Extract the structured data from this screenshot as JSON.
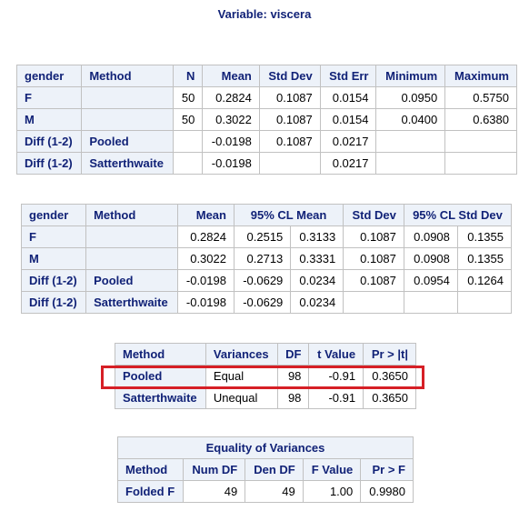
{
  "title": "Variable: viscera",
  "stats_table": {
    "headers": [
      "gender",
      "Method",
      "N",
      "Mean",
      "Std Dev",
      "Std Err",
      "Minimum",
      "Maximum"
    ],
    "rows": [
      [
        "F",
        "",
        "50",
        "0.2824",
        "0.1087",
        "0.0154",
        "0.0950",
        "0.5750"
      ],
      [
        "M",
        "",
        "50",
        "0.3022",
        "0.1087",
        "0.0154",
        "0.0400",
        "0.6380"
      ],
      [
        "Diff (1-2)",
        "Pooled",
        "",
        "-0.0198",
        "0.1087",
        "0.0217",
        "",
        ""
      ],
      [
        "Diff (1-2)",
        "Satterthwaite",
        "",
        "-0.0198",
        "",
        "0.0217",
        "",
        ""
      ]
    ]
  },
  "cl_table": {
    "headers": [
      "gender",
      "Method",
      "Mean",
      "95% CL Mean",
      "Std Dev",
      "95% CL Std Dev"
    ],
    "rows": [
      [
        "F",
        "",
        "0.2824",
        "0.2515",
        "0.3133",
        "0.1087",
        "0.0908",
        "0.1355"
      ],
      [
        "M",
        "",
        "0.3022",
        "0.2713",
        "0.3331",
        "0.1087",
        "0.0908",
        "0.1355"
      ],
      [
        "Diff (1-2)",
        "Pooled",
        "-0.0198",
        "-0.0629",
        "0.0234",
        "0.1087",
        "0.0954",
        "0.1264"
      ],
      [
        "Diff (1-2)",
        "Satterthwaite",
        "-0.0198",
        "-0.0629",
        "0.0234",
        "",
        "",
        ""
      ]
    ]
  },
  "ttest_table": {
    "headers": [
      "Method",
      "Variances",
      "DF",
      "t Value",
      "Pr > |t|"
    ],
    "rows": [
      [
        "Pooled",
        "Equal",
        "98",
        "-0.91",
        "0.3650"
      ],
      [
        "Satterthwaite",
        "Unequal",
        "98",
        "-0.91",
        "0.3650"
      ]
    ],
    "highlight_row": "Pooled",
    "highlight_color": "#d61f26"
  },
  "equality_table": {
    "caption": "Equality of Variances",
    "headers": [
      "Method",
      "Num DF",
      "Den DF",
      "F Value",
      "Pr > F"
    ],
    "rows": [
      [
        "Folded F",
        "49",
        "49",
        "1.00",
        "0.9980"
      ]
    ]
  },
  "colors": {
    "header_bg": "#edf2f9",
    "header_text": "#112277",
    "grid": "#c1c1c1"
  }
}
